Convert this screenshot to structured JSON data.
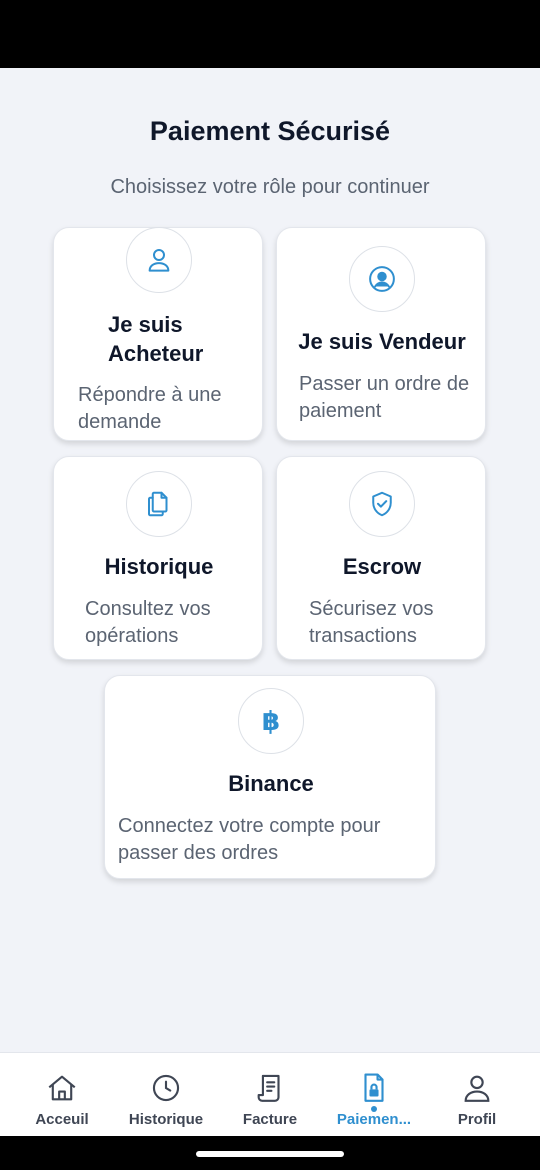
{
  "header": {
    "title": "Paiement Sécurisé",
    "subtitle": "Choisissez votre rôle pour continuer"
  },
  "cards": [
    {
      "icon": "user-icon",
      "title": "Je suis Acheteur",
      "description": "Répondre à une demande"
    },
    {
      "icon": "user-circle-icon",
      "title": "Je suis Vendeur",
      "description": "Passer un ordre de paiement"
    },
    {
      "icon": "documents-icon",
      "title": "Historique",
      "description": "Consultez vos opérations"
    },
    {
      "icon": "shield-check-icon",
      "title": "Escrow",
      "description": "Sécurisez vos transactions"
    },
    {
      "icon": "bitcoin-icon",
      "title": "Binance",
      "description": "Connectez votre compte pour passer des ordres"
    }
  ],
  "bottom_nav": {
    "items": [
      {
        "label": "Acceuil",
        "icon": "home-icon"
      },
      {
        "label": "Historique",
        "icon": "clock-icon"
      },
      {
        "label": "Facture",
        "icon": "receipt-icon"
      },
      {
        "label": "Paiemen...",
        "icon": "payment-lock-icon",
        "active": true
      },
      {
        "label": "Profil",
        "icon": "person-icon"
      }
    ]
  },
  "colors": {
    "accent": "#2f8fcf",
    "text_primary": "#0f172a",
    "text_secondary": "#5b6472",
    "background": "#f1f3f8"
  }
}
